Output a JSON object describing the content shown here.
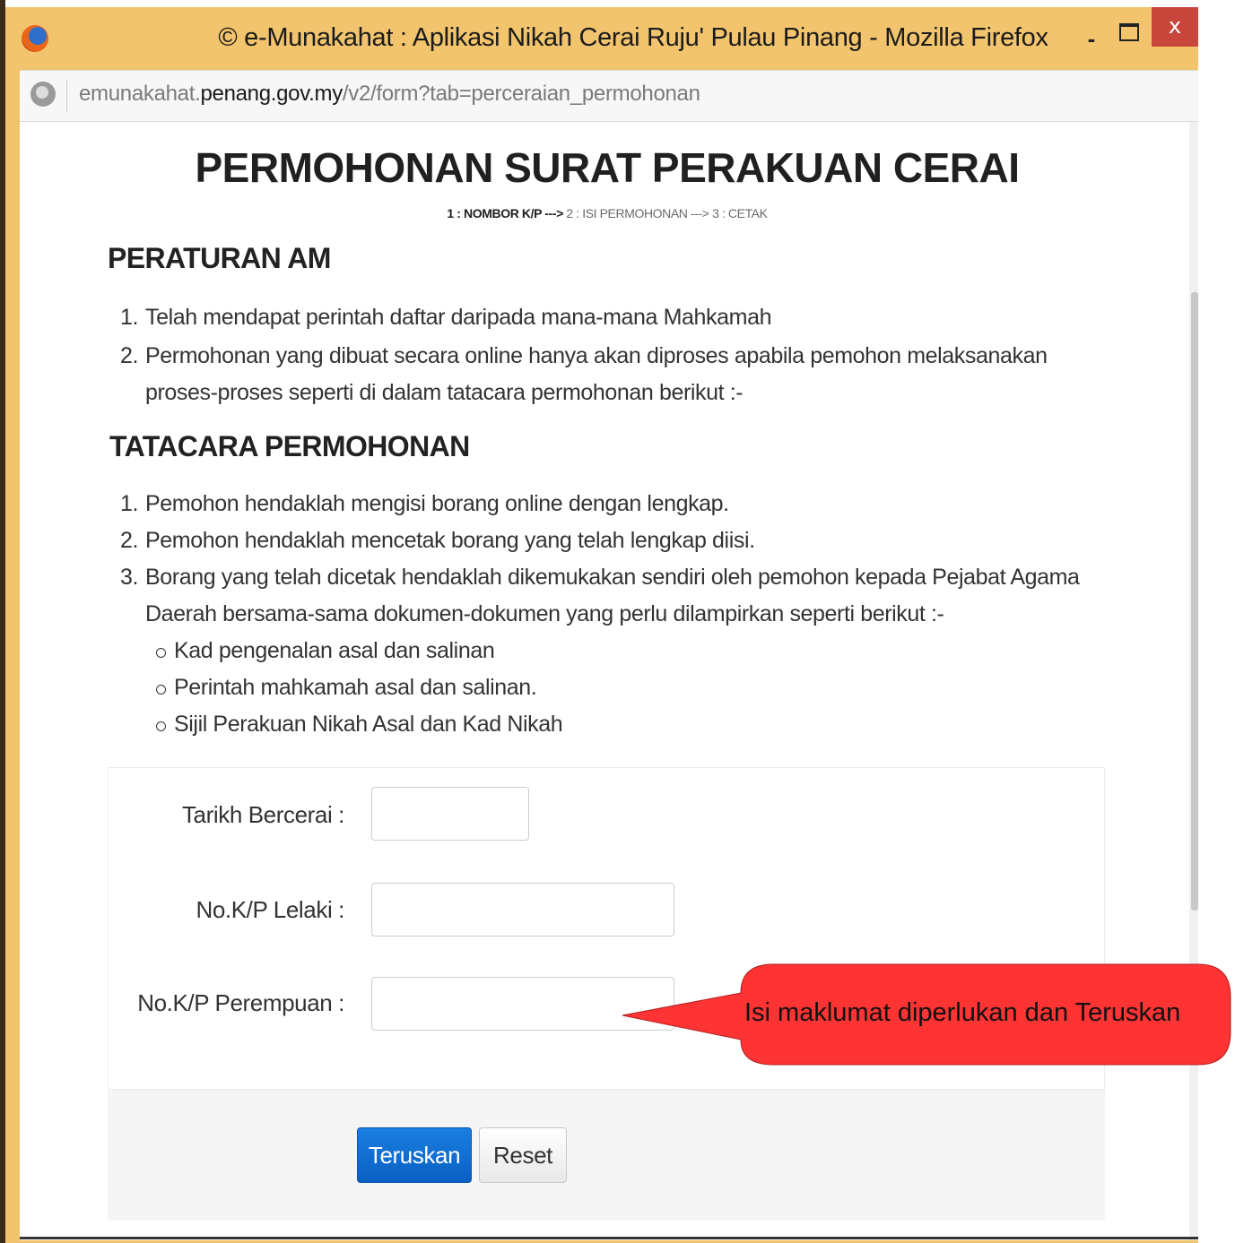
{
  "window": {
    "title": "© e-Munakahat : Aplikasi Nikah Cerai Ruju' Pulau Pinang - Mozilla Firefox",
    "min_glyph": "-",
    "close_glyph": "x"
  },
  "address": {
    "url_prefix": "emunakahat.",
    "url_domain": "penang.gov.my",
    "url_path": "/v2/form?tab=perceraian_permohonan"
  },
  "page": {
    "title": "PERMOHONAN SURAT PERAKUAN CERAI",
    "steps": {
      "step1": "1 : NOMBOR K/P",
      "arrow1": " ---> ",
      "step2": "2 : ISI PERMOHONAN",
      "arrow2": " ---> ",
      "step3": "3 : CETAK"
    }
  },
  "rules": {
    "heading": "PERATURAN AM",
    "items": [
      {
        "num": "1.",
        "text": "Telah mendapat perintah daftar daripada mana-mana Mahkamah"
      },
      {
        "num": "2.",
        "text": "Permohonan yang dibuat secara online hanya akan diproses apabila pemohon melaksanakan proses-proses seperti di dalam tatacara permohonan berikut :-"
      }
    ]
  },
  "procedure": {
    "heading": "TATACARA PERMOHONAN",
    "items": [
      {
        "num": "1.",
        "text": "Pemohon hendaklah mengisi borang online dengan lengkap."
      },
      {
        "num": "2.",
        "text": "Pemohon hendaklah mencetak borang yang telah lengkap diisi."
      },
      {
        "num": "3.",
        "text": "Borang yang telah dicetak hendaklah dikemukakan sendiri oleh pemohon kepada Pejabat Agama Daerah bersama-sama dokumen-dokumen yang perlu dilampirkan seperti berikut :-"
      }
    ],
    "documents": [
      "Kad pengenalan asal dan salinan",
      "Perintah mahkamah asal dan salinan.",
      "Sijil Perakuan Nikah Asal dan Kad Nikah"
    ]
  },
  "form": {
    "divorce_date_label": "Tarikh Bercerai :",
    "divorce_date_value": "",
    "male_ic_label": "No.K/P Lelaki :",
    "male_ic_value": "",
    "female_ic_label": "No.K/P Perempuan :",
    "female_ic_value": "",
    "submit_label": "Teruskan",
    "reset_label": "Reset"
  },
  "callout": {
    "text": "Isi maklumat diperlukan dan Teruskan",
    "fill": "#fe3333"
  },
  "colors": {
    "window_frame": "#f2c46d",
    "close_button": "#c9463d",
    "primary_button": "#0a6fd6"
  }
}
